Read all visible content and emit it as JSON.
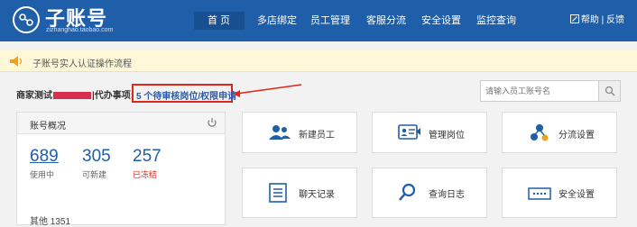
{
  "header": {
    "title": "子账号",
    "subtitle": "zizhanghao.taobao.com",
    "nav": [
      "首 页",
      "多店绑定",
      "员工管理",
      "客服分流",
      "安全设置",
      "监控查询"
    ],
    "active_index": 0,
    "help": "帮助 | 反馈"
  },
  "notice": {
    "text": "子账号实人认证操作流程"
  },
  "pending": {
    "label_before": "商家测试",
    "label_after": "|代办事项:",
    "highlight": "5 个待审核岗位/权限申请",
    "accent_color": "#e1251b"
  },
  "search": {
    "placeholder": "请输入员工账号名"
  },
  "account_panel": {
    "title": "账号概况",
    "stats": [
      {
        "value": "689",
        "label": "使用中"
      },
      {
        "value": "305",
        "label": "可新建"
      },
      {
        "value": "257",
        "label": "已冻结"
      }
    ],
    "partial_text": "其他    1351"
  },
  "tiles": [
    {
      "label": "新建员工",
      "icon": "users-icon"
    },
    {
      "label": "管理岗位",
      "icon": "id-card-icon"
    },
    {
      "label": "分流设置",
      "icon": "flow-icon"
    },
    {
      "label": "聊天记录",
      "icon": "document-icon"
    },
    {
      "label": "查询日志",
      "icon": "search-icon"
    },
    {
      "label": "安全设置",
      "icon": "password-icon"
    }
  ],
  "colors": {
    "brand": "#1f5ea8",
    "highlight": "#e1251b"
  }
}
